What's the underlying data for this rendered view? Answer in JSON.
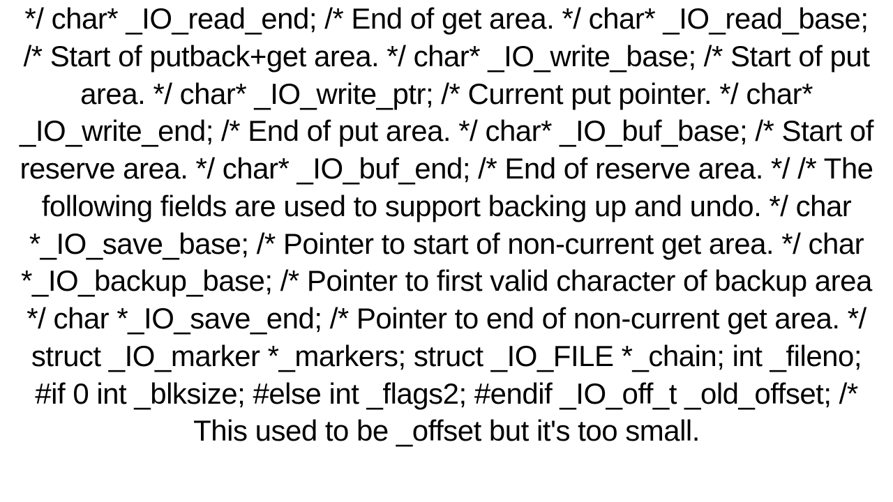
{
  "code_text": "*/   char* _IO_read_end;   /* End of get area. */   char* _IO_read_base;   /* Start of putback+get area. */   char* _IO_write_base; /* Start of put area. */   char* _IO_write_ptr;   /* Current put pointer. */   char* _IO_write_end;   /* End of put area. */   char* _IO_buf_base;   /* Start of reserve area. */   char* _IO_buf_end;    /* End of reserve area. */   /* The following fields are used to support backing up and undo. */   char *_IO_save_base; /* Pointer to start of non-current get area. */   char *_IO_backup_base;   /* Pointer to first valid character of backup area */   char *_IO_save_end; /* Pointer to end of non-current get area. */    struct _IO_marker *_markers;    struct _IO_FILE *_chain;    int _fileno; #if 0   int _blksize; #else   int _flags2; #endif   _IO_off_t _old_offset; /* This used to be _offset but it's too small."
}
